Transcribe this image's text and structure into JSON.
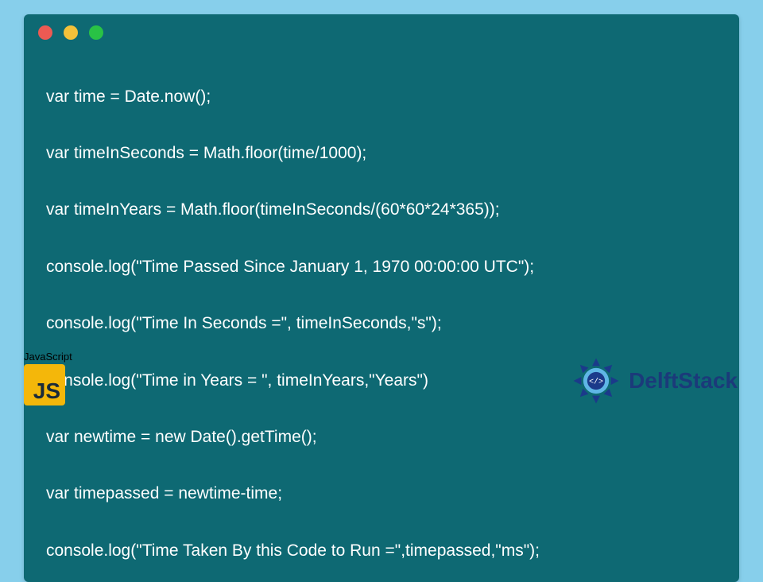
{
  "code": {
    "lines": [
      "var time = Date.now();",
      "var timeInSeconds = Math.floor(time/1000);",
      "var timeInYears = Math.floor(timeInSeconds/(60*60*24*365));",
      "console.log(\"Time Passed Since January 1, 1970 00:00:00 UTC\");",
      "console.log(\"Time In Seconds =\", timeInSeconds,\"s\");",
      "console.log(\"Time in Years = \", timeInYears,\"Years\")",
      "var newtime = new Date().getTime();",
      "var timepassed = newtime-time;",
      "console.log(\"Time Taken By this Code to Run =\",timepassed,\"ms\");"
    ]
  },
  "badge": {
    "language_label": "JavaScript",
    "tile_text": "JS"
  },
  "brand": {
    "name": "DelftStack"
  },
  "colors": {
    "page_bg": "#87cfeb",
    "window_bg": "#0e6973",
    "code_text": "#ffffff",
    "js_tile": "#f4b70a",
    "brand_text": "#1b3a7a",
    "dot_red": "#ec5a53",
    "dot_yellow": "#f4c13a",
    "dot_green": "#29c245"
  }
}
